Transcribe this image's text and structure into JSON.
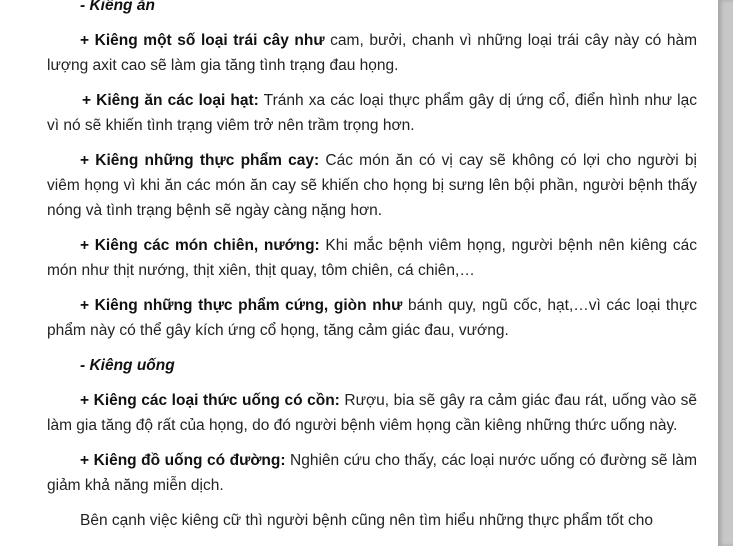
{
  "document": {
    "sections": [
      {
        "heading": "- Kiêng ăn",
        "items": [
          {
            "bold": "+ Kiêng một số loại trái cây như",
            "text": " cam, bưởi, chanh vì những loại trái cây này có hàm lượng axit cao sẽ làm gia tăng tình trạng đau họng."
          },
          {
            "bold": "+ Kiêng ăn các loại hạt:",
            "text": " Tránh xa các loại thực phẩm gây dị ứng cổ, điển hình như lạc vì nó sẽ khiến tình trạng viêm trở nên trầm trọng hơn."
          },
          {
            "bold": "+ Kiêng những thực phẩm cay:",
            "text": " Các món ăn có vị cay sẽ không có lợi cho người bị viêm họng vì khi ăn các món ăn cay sẽ khiến cho họng bị sưng lên bội phần, người bệnh thấy nóng và tình trạng bệnh sẽ ngày càng nặng hơn."
          },
          {
            "bold": "+ Kiêng các món chiên, nướng:",
            "text": " Khi mắc bệnh viêm họng, người bệnh nên kiêng các món như thịt nướng, thịt xiên, thịt quay, tôm chiên, cá chiên,…"
          },
          {
            "bold": "+ Kiêng những thực phẩm cứng, giòn như",
            "text": " bánh quy, ngũ cốc, hạt,…vì các loại thực phẩm này có thể gây kích ứng cổ họng, tăng cảm giác đau, vướng."
          }
        ]
      },
      {
        "heading": "- Kiêng uống",
        "items": [
          {
            "bold": "+ Kiêng các loại thức uống có cồn:",
            "text": " Rượu, bia sẽ gây ra cảm giác đau rát, uống vào sẽ làm gia tăng độ rất của họng, do đó người bệnh viêm họng cần kiêng những thức uống này."
          },
          {
            "bold": "+ Kiêng đồ uống có đường:",
            "text": " Nghiên cứu cho thấy, các loại nước uống có đường sẽ làm giảm khả năng miễn dịch."
          }
        ]
      }
    ],
    "closing": "Bên cạnh việc kiêng cữ thì người bệnh cũng nên tìm hiểu những thực phẩm tốt cho"
  }
}
